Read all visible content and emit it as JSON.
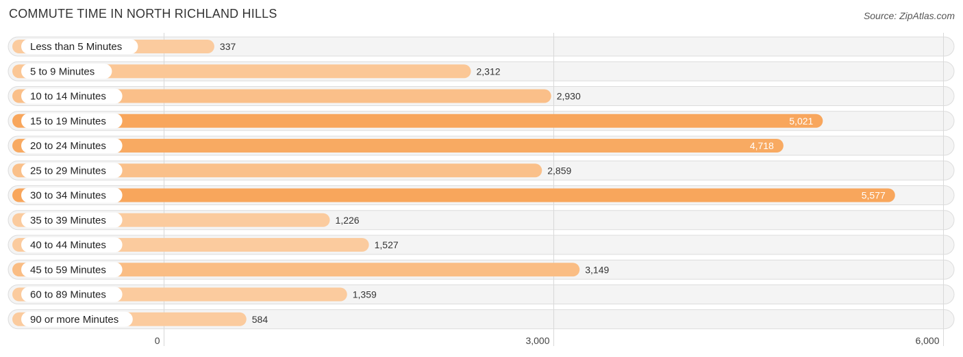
{
  "header": {
    "title": "COMMUTE TIME IN NORTH RICHLAND HILLS",
    "source": "Source: ZipAtlas.com"
  },
  "colors": {
    "bar_light": "#fbcb9e",
    "bar_strong": "#f8a65c",
    "track": "#f4f4f4",
    "value_text_outside": "#333333",
    "value_text_inside": "#ffffff"
  },
  "chart_data": {
    "type": "bar",
    "orientation": "horizontal",
    "title": "COMMUTE TIME IN NORTH RICHLAND HILLS",
    "xlabel": "",
    "ylabel": "",
    "xlim": [
      0,
      6000
    ],
    "x_ticks": [
      0,
      3000,
      6000
    ],
    "x_tick_labels": [
      "0",
      "3,000",
      "6,000"
    ],
    "grid": true,
    "legend": "none",
    "categories": [
      "Less than 5 Minutes",
      "5 to 9 Minutes",
      "10 to 14 Minutes",
      "15 to 19 Minutes",
      "20 to 24 Minutes",
      "25 to 29 Minutes",
      "30 to 34 Minutes",
      "35 to 39 Minutes",
      "40 to 44 Minutes",
      "45 to 59 Minutes",
      "60 to 89 Minutes",
      "90 or more Minutes"
    ],
    "values": [
      337,
      2312,
      2930,
      5021,
      4718,
      2859,
      5577,
      1226,
      1527,
      3149,
      1359,
      584
    ],
    "value_labels": [
      "337",
      "2,312",
      "2,930",
      "5,021",
      "4,718",
      "2,859",
      "5,577",
      "1,226",
      "1,527",
      "3,149",
      "1,359",
      "584"
    ]
  }
}
